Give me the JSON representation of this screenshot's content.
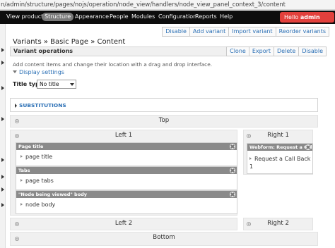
{
  "browser": {
    "url": "n/admin/structure/pages/nojs/operation/node_view/handlers/node_view_panel_context_3/content"
  },
  "toolbar": {
    "items": [
      "View products",
      "Structure",
      "Appearance",
      "People",
      "Modules",
      "Configuration",
      "Reports",
      "Help"
    ],
    "active": "Structure",
    "hello_prefix": "Hello ",
    "user": "admin"
  },
  "top_actions": [
    "Disable",
    "Add variant",
    "Import variant",
    "Reorder variants"
  ],
  "page": {
    "heading": "Variants » Basic Page » Content",
    "operations_title": "Variant operations",
    "operations_actions": [
      "Clone",
      "Export",
      "Delete",
      "Disable"
    ],
    "help_text": "Add content items and change their location with a drag and drop interface.",
    "display_settings": "Display settings",
    "title_type_label": "Title type",
    "title_type_value": "No title",
    "substitutions": "SUBSTITUTIONS"
  },
  "layout": {
    "top": "Top",
    "left1": "Left 1",
    "right1": "Right 1",
    "left2": "Left 2",
    "right2": "Right 2",
    "bottom": "Bottom"
  },
  "panes": {
    "left1": [
      {
        "title": "Page title",
        "body": "page title"
      },
      {
        "title": "Tabs",
        "body": "page tabs"
      },
      {
        "title": "\"Node being viewed\" body",
        "body": "node body"
      }
    ],
    "right1": [
      {
        "title": "Webform: Request a Call",
        "body_line1": "Request a Call Back",
        "body_line2": "1"
      }
    ]
  },
  "colors": {
    "toolbar_bg": "#0d0d0d",
    "hello_bg": "#e2403c",
    "link": "#2a6fb5",
    "pane_header": "#8a8a8a"
  }
}
